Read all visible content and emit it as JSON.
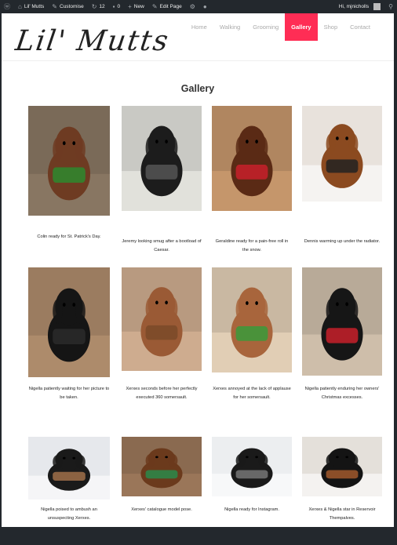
{
  "admin_bar": {
    "site_name": "Lil' Mutts",
    "customise": "Customise",
    "updates": "12",
    "comments": "0",
    "new": "New",
    "edit_page": "Edit Page",
    "greeting": "Hi, mjnicholls"
  },
  "site": {
    "logo_text": "Lil' Mutts"
  },
  "nav": {
    "items": [
      {
        "label": "Home"
      },
      {
        "label": "Walking"
      },
      {
        "label": "Grooming"
      },
      {
        "label": "Gallery",
        "active": true
      },
      {
        "label": "Shop"
      },
      {
        "label": "Contact"
      }
    ]
  },
  "page": {
    "title": "Gallery"
  },
  "gallery": [
    {
      "caption": "Colin ready for St. Patrick's Day.",
      "bg": "#7a6a58",
      "dog": "#6e3b22",
      "acc": "#2e8a2e"
    },
    {
      "caption": "Jeremy looking smug after a bootload of Caesar.",
      "bg": "#c9c9c4",
      "dog": "#1c1c1c",
      "acc": "#555555"
    },
    {
      "caption": "Geraldine ready for a pain-free roll in the snow.",
      "bg": "#b08660",
      "dog": "#5a2a15",
      "acc": "#c8202a"
    },
    {
      "caption": "Dennis warming up under the radiator.",
      "bg": "#e8e2dc",
      "dog": "#8b4a20",
      "acc": "#222222"
    },
    {
      "caption": "Nigella patiently waiting for her picture to be taken.",
      "bg": "#9b7c60",
      "dog": "#151515",
      "acc": "#2a2a2a"
    },
    {
      "caption": "Xerxes seconds before her perfectly executed 360 somersault.",
      "bg": "#b89a80",
      "dog": "#9a5a35",
      "acc": "#7a4a28"
    },
    {
      "caption": "Xerxes annoyed at the lack of applause for her somersault.",
      "bg": "#c9b8a2",
      "dog": "#a8653c",
      "acc": "#3a9a3a"
    },
    {
      "caption": "Nigella patiently enduring her owners' Christmas excesses.",
      "bg": "#b8aa98",
      "dog": "#161616",
      "acc": "#c8202a"
    },
    {
      "caption": "Nigella poised to ambush an unsuspecting Xerxes.",
      "bg": "#e6e8ec",
      "dog": "#1a1a1a",
      "acc": "#a0704a"
    },
    {
      "caption": "Xerxes' catalogue model pose.",
      "bg": "#8a6a50",
      "dog": "#6b3a1c",
      "acc": "#2a8a4a"
    },
    {
      "caption": "Nigella ready for Instagram.",
      "bg": "#eceef0",
      "dog": "#1a1a1a",
      "acc": "#777777"
    },
    {
      "caption": "Xerxes & Nigella star in Reservoir Thempalves.",
      "bg": "#e4e0da",
      "dog": "#141414",
      "acc": "#a0582c"
    }
  ]
}
